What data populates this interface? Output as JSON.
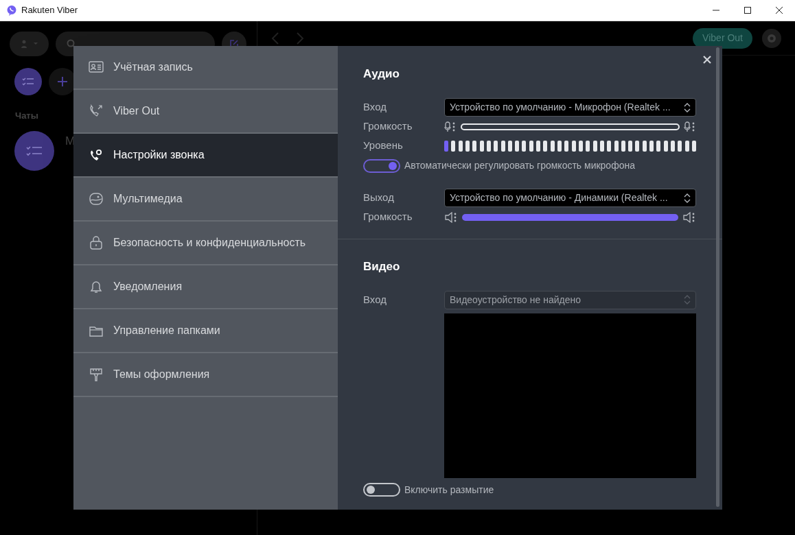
{
  "window": {
    "title": "Rakuten Viber"
  },
  "background": {
    "chats_heading": "Чаты",
    "chat_preview": "M",
    "viber_out_button": "Viber Out"
  },
  "settings": {
    "menu": [
      {
        "label": "Учётная запись",
        "selected": false
      },
      {
        "label": "Viber Out",
        "selected": false
      },
      {
        "label": "Настройки звонка",
        "selected": true
      },
      {
        "label": "Мультимедиа",
        "selected": false
      },
      {
        "label": "Безопасность и конфиденциальность",
        "selected": false
      },
      {
        "label": "Уведомления",
        "selected": false
      },
      {
        "label": "Управление папками",
        "selected": false
      },
      {
        "label": "Темы оформления",
        "selected": false
      }
    ],
    "audio": {
      "heading": "Аудио",
      "input_label": "Вход",
      "input_device": "Устройство по умолчанию - Микрофон (Realtek ...",
      "input_volume_label": "Громкость",
      "input_volume": {
        "level": 0
      },
      "meter_label": "Уровень",
      "meter": {
        "level": 0.03
      },
      "auto_gain": {
        "label": "Автоматически регулировать громкость микрофона",
        "on": true
      },
      "output_label": "Выход",
      "output_device": "Устройство по умолчанию - Динамики (Realtek ...",
      "output_volume_label": "Громкость",
      "output_volume": {
        "level": 1
      }
    },
    "video": {
      "heading": "Видео",
      "input_label": "Вход",
      "input_device": "Видеоустройство не найдено",
      "blur": {
        "label": "Включить размытие",
        "on": false
      }
    }
  }
}
